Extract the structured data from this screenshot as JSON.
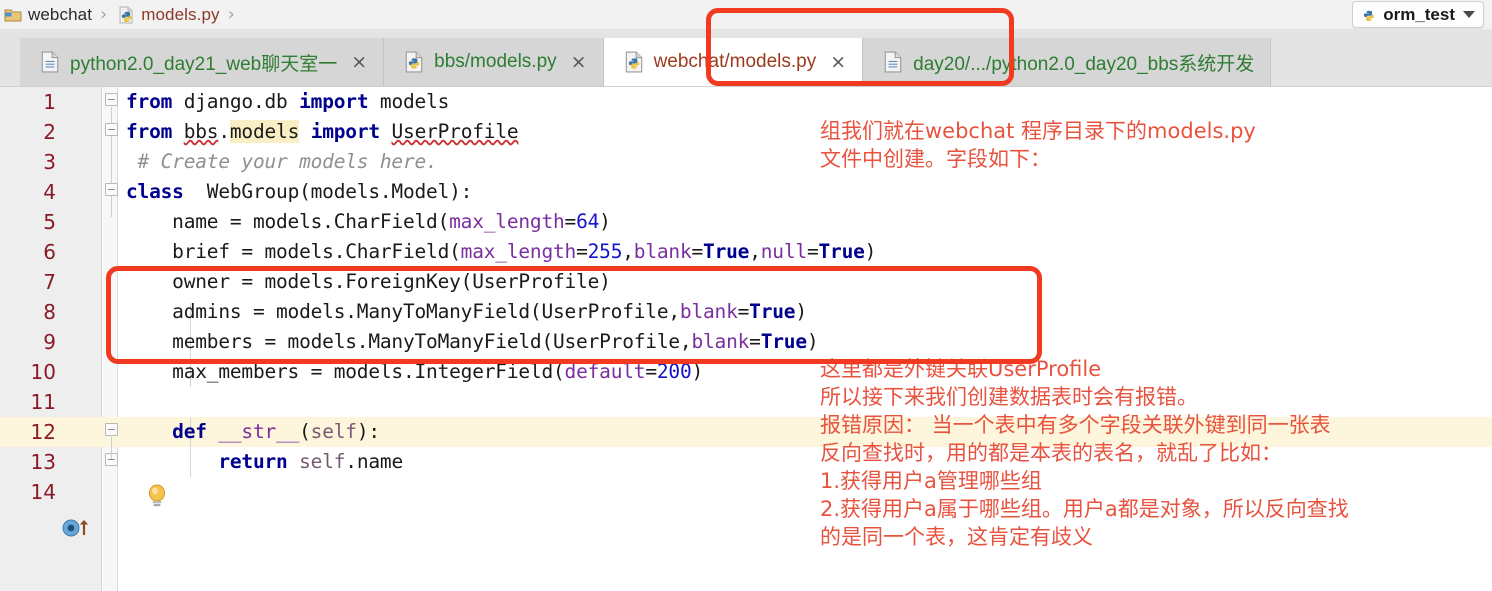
{
  "breadcrumb": {
    "items": [
      {
        "label": "webchat",
        "icon": "folder-icon",
        "style": "plain"
      },
      {
        "label": "models.py",
        "icon": "python-file-icon",
        "style": "python"
      }
    ],
    "separator": "›"
  },
  "run_config": {
    "label": "orm_test",
    "icon": "python-config-icon",
    "caret": "chevron-down-icon"
  },
  "tabs": [
    {
      "label": "python2.0_day21_web聊天室一",
      "icon": "text-file-icon",
      "close": "×",
      "active": false,
      "color": "green"
    },
    {
      "label": "bbs/models.py",
      "icon": "python-file-icon",
      "close": "×",
      "active": false,
      "color": "green"
    },
    {
      "label": "webchat/models.py",
      "icon": "python-file-icon",
      "close": "×",
      "active": true,
      "color": "brown"
    },
    {
      "label": "day20/.../python2.0_day20_bbs系统开发",
      "icon": "text-file-icon",
      "close": "",
      "active": false,
      "color": "green"
    }
  ],
  "editor": {
    "gutter_numbers": [
      "1",
      "2",
      "3",
      "4",
      "5",
      "6",
      "7",
      "8",
      "9",
      "10",
      "11",
      "12",
      "13",
      "14"
    ],
    "highlighted_line": 12,
    "lines": [
      {
        "n": "1",
        "text": "from django.db import models"
      },
      {
        "n": "2",
        "text": "from bbs.models import UserProfile"
      },
      {
        "n": "3",
        "text": "# Create your models here."
      },
      {
        "n": "4",
        "text": "class  WebGroup(models.Model):"
      },
      {
        "n": "5",
        "text": "    name = models.CharField(max_length=64)"
      },
      {
        "n": "6",
        "text": "    brief = models.CharField(max_length=255,blank=True,null=True)"
      },
      {
        "n": "7",
        "text": "    owner = models.ForeignKey(UserProfile)"
      },
      {
        "n": "8",
        "text": "    admins = models.ManyToManyField(UserProfile,blank=True)"
      },
      {
        "n": "9",
        "text": "    members = models.ManyToManyField(UserProfile,blank=True)"
      },
      {
        "n": "10",
        "text": "    max_members = models.IntegerField(default=200)"
      },
      {
        "n": "11",
        "text": ""
      },
      {
        "n": "12",
        "text": "    def __str__(self):"
      },
      {
        "n": "13",
        "text": "        return self.name"
      },
      {
        "n": "14",
        "text": ""
      }
    ],
    "gutter_icons": [
      {
        "name": "intention-bulb-icon",
        "line": 11
      },
      {
        "name": "overridden-method-icon",
        "line": 12
      }
    ]
  },
  "annotations": {
    "top_note": [
      "组我们就在webchat 程序目录下的models.py",
      "文件中创建。字段如下："
    ],
    "bottom_note": [
      "这里都是外键关联UserProfile",
      "所以接下来我们创建数据表时会有报错。",
      "报错原因： 当一个表中有多个字段关联外键到同一张表",
      "反向查找时，用的都是本表的表名，就乱了比如：",
      "1.获得用户a管理哪些组",
      "2.获得用户a属于哪些组。用户a都是对象，所以反向查找",
      "的是同一个表，这肯定有歧义"
    ],
    "highlight_boxes": [
      {
        "name": "tab-highlight-box",
        "target": "webchat/models.py tab"
      },
      {
        "name": "code-highlight-box",
        "target": "lines 7-9 foreign key fields"
      }
    ],
    "accent_color": "#f23a21",
    "text_color": "#e8533f"
  },
  "colors": {
    "keyword": "#00008f",
    "number": "#1414cc",
    "parameter": "#7a2f9e",
    "comment": "#909090",
    "line_number": "#8a1a28",
    "gutter_bg": "#eeeeee",
    "tab_active_bg": "#ffffff",
    "tab_inactive_bg": "#d6d6d6",
    "line_highlight_bg": "#fdf6dd",
    "search_highlight_bg": "#faeec4"
  }
}
